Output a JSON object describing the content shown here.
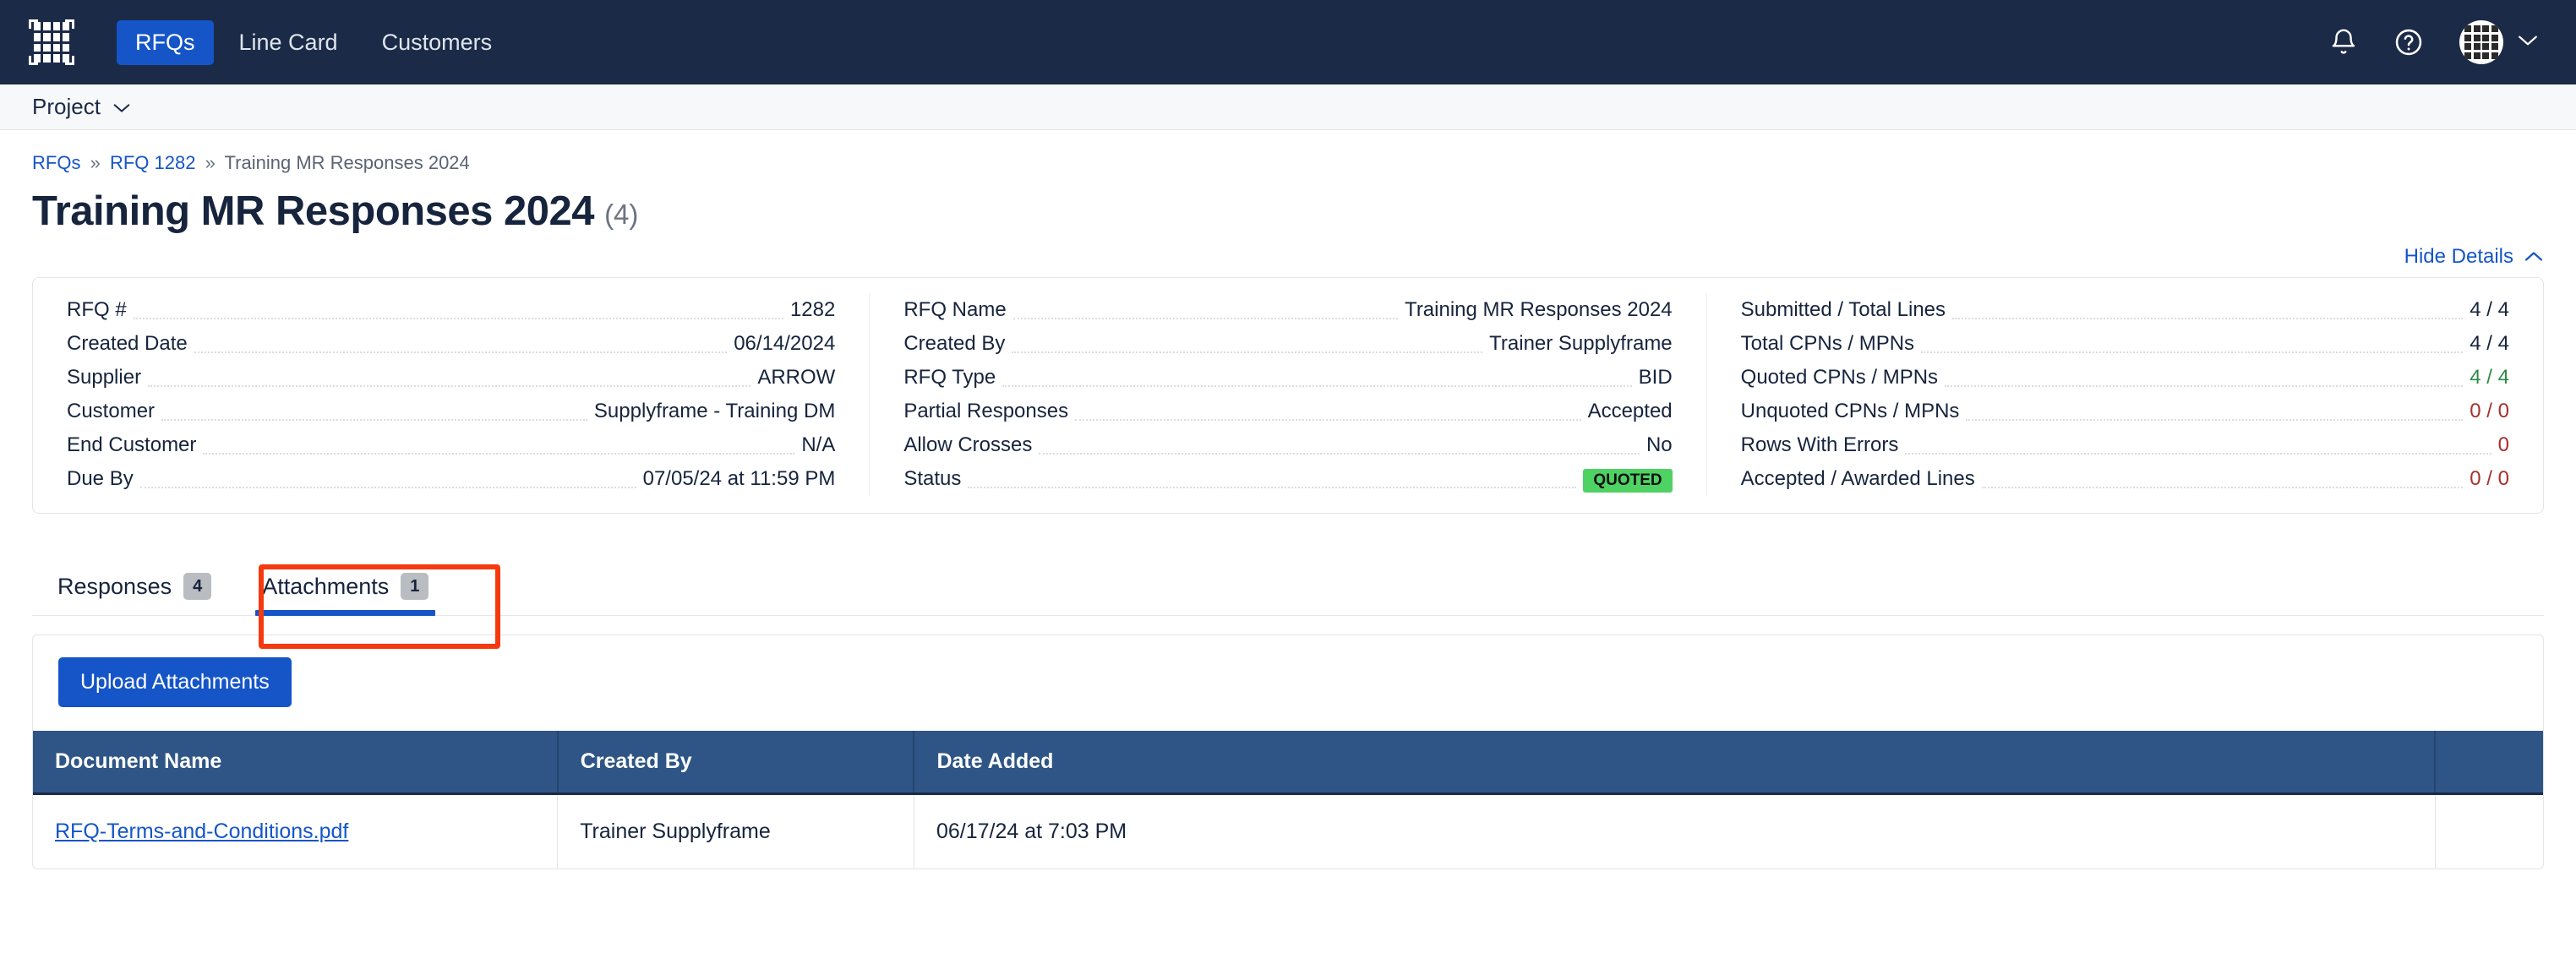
{
  "topnav": {
    "logo_icon": "grid-logo-icon",
    "items": [
      {
        "label": "RFQs",
        "active": true
      },
      {
        "label": "Line Card",
        "active": false
      },
      {
        "label": "Customers",
        "active": false
      }
    ],
    "bell_icon": "bell-icon",
    "help_icon": "question-circle-icon",
    "avatar_icon": "avatar-grid-icon",
    "avatar_chevron_icon": "chevron-down-icon",
    "accent_blue": "#1555c8",
    "nav_background": "#1b2a47"
  },
  "projectbar": {
    "label": "Project",
    "chevron_icon": "chevron-down-icon"
  },
  "breadcrumb": {
    "items": [
      {
        "label": "RFQs",
        "link": true
      },
      {
        "label": "RFQ 1282",
        "link": true
      },
      {
        "label": "Training MR Responses 2024",
        "link": false
      }
    ],
    "separator": "»"
  },
  "header": {
    "title": "Training MR Responses 2024",
    "count": "(4)",
    "hide_details_label": "Hide Details",
    "hide_details_chevron": "chevron-up-icon"
  },
  "details": {
    "columns": [
      {
        "rows": [
          {
            "label": "RFQ #",
            "value": "1282"
          },
          {
            "label": "Created Date",
            "value": "06/14/2024"
          },
          {
            "label": "Supplier",
            "value": "ARROW"
          },
          {
            "label": "Customer",
            "value": "Supplyframe - Training DM"
          },
          {
            "label": "End Customer",
            "value": "N/A"
          },
          {
            "label": "Due By",
            "value": "07/05/24 at 11:59 PM"
          }
        ]
      },
      {
        "rows": [
          {
            "label": "RFQ Name",
            "value": "Training MR Responses 2024"
          },
          {
            "label": "Created By",
            "value": "Trainer Supplyframe"
          },
          {
            "label": "RFQ Type",
            "value": "BID"
          },
          {
            "label": "Partial Responses",
            "value": "Accepted"
          },
          {
            "label": "Allow Crosses",
            "value": "No"
          },
          {
            "label": "Status",
            "value": "QUOTED",
            "badge": true,
            "badge_color": "#4fd264"
          }
        ]
      },
      {
        "rows": [
          {
            "label": "Submitted / Total Lines",
            "value": "4 / 4"
          },
          {
            "label": "Total CPNs / MPNs",
            "value": "4 / 4"
          },
          {
            "label": "Quoted CPNs / MPNs",
            "value": "4 / 4",
            "tone": "green"
          },
          {
            "label": "Unquoted CPNs / MPNs",
            "value": "0 / 0",
            "tone": "red"
          },
          {
            "label": "Rows With Errors",
            "value": "0",
            "tone": "red"
          },
          {
            "label": "Accepted / Awarded Lines",
            "value": "0 / 0",
            "tone": "red"
          }
        ]
      }
    ]
  },
  "tabs": [
    {
      "label": "Responses",
      "count": "4",
      "active": false
    },
    {
      "label": "Attachments",
      "count": "1",
      "active": true
    }
  ],
  "annotation": {
    "target": "Attachments",
    "color": "#f63a10"
  },
  "attachments_panel": {
    "upload_button_label": "Upload Attachments",
    "table": {
      "headers": [
        "Document Name",
        "Created By",
        "Date Added",
        ""
      ],
      "rows": [
        {
          "document_name": "RFQ-Terms-and-Conditions.pdf",
          "created_by": "Trainer Supplyframe",
          "date_added": "06/17/24 at 7:03 PM",
          "actions": ""
        }
      ]
    }
  }
}
